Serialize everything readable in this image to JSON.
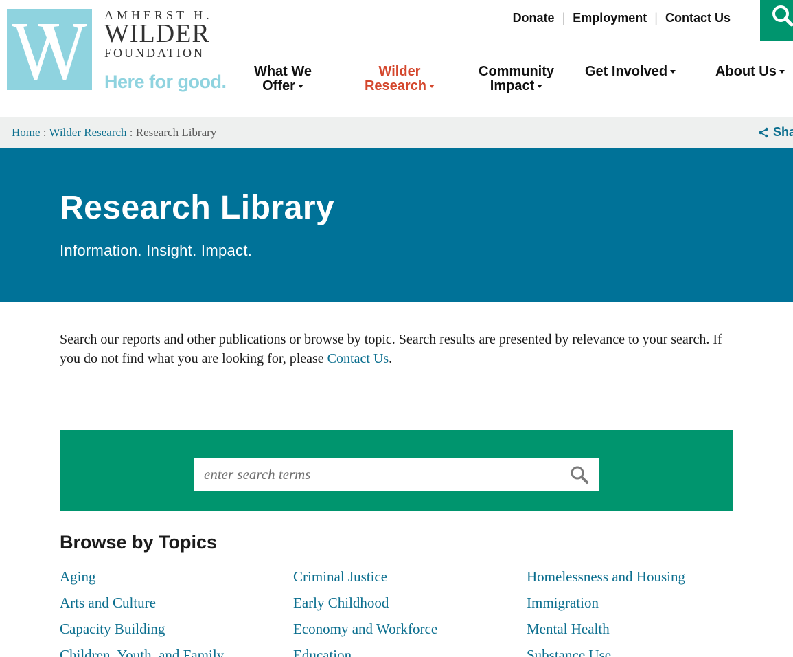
{
  "logo": {
    "line1": "AMHERST H.",
    "line2": "WILDER",
    "line3": "FOUNDATION",
    "tagline": "Here for good."
  },
  "utility_nav": [
    "Donate",
    "Employment",
    "Contact Us"
  ],
  "main_nav": [
    {
      "line1": "What We",
      "line2": "Offer"
    },
    {
      "line1": "Wilder",
      "line2": "Research"
    },
    {
      "line1": "Community",
      "line2": "Impact"
    },
    {
      "line1": "Get Involved",
      "line2": ""
    },
    {
      "line1": "About Us",
      "line2": ""
    }
  ],
  "breadcrumb": {
    "items": [
      "Home",
      "Wilder Research",
      "Research Library"
    ],
    "separator": ":"
  },
  "share_label": "Sha",
  "hero": {
    "title": "Research Library",
    "subtitle": "Information. Insight. Impact."
  },
  "intro": {
    "text": "Search our reports and other publications or browse by topic. Search results are presented by relevance to your search. If you do not find what you are looking for, please ",
    "link": "Contact Us",
    "suffix": "."
  },
  "search": {
    "placeholder": "enter search terms"
  },
  "topics": {
    "title": "Browse by Topics",
    "columns": [
      [
        "Aging",
        "Arts and Culture",
        "Capacity Building",
        "Children, Youth, and Family"
      ],
      [
        "Criminal Justice",
        "Early Childhood",
        "Economy and Workforce",
        "Education"
      ],
      [
        "Homelessness and Housing",
        "Immigration",
        "Mental Health",
        "Substance Use"
      ]
    ]
  },
  "colors": {
    "accent_teal": "#007298",
    "accent_green": "#00956e",
    "logo_blue": "#8fd3df",
    "active_nav": "#d4472d",
    "link": "#0c6f8f"
  }
}
